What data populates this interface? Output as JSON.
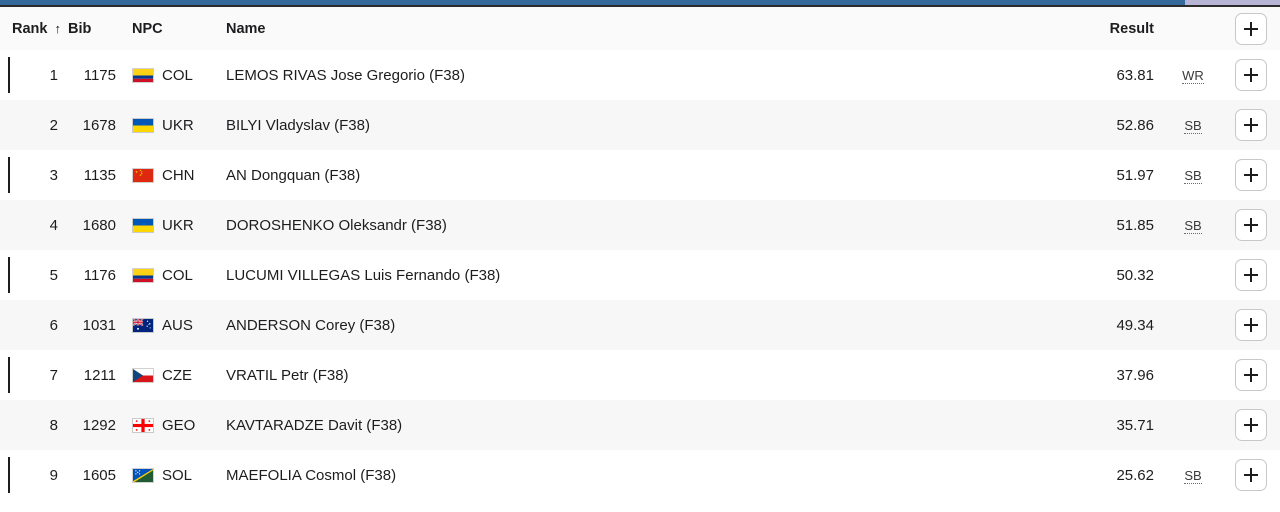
{
  "progress": {
    "name": "page-load-progress",
    "percent": 92.6,
    "fill_color": "#36699b",
    "track_color": "#b7b4d6"
  },
  "table": {
    "columns": {
      "rank": "Rank",
      "sort_indicator": "↑",
      "bib": "Bib",
      "npc": "NPC",
      "name": "Name",
      "result": "Result",
      "badge": "",
      "action": ""
    },
    "add_button_label": "+",
    "rows": [
      {
        "rank": "1",
        "bib": "1175",
        "npc": "COL",
        "flag": "flag-colombia",
        "name": "LEMOS RIVAS Jose Gregorio (",
        "class_code": "F38",
        "name_suffix": ")",
        "result": "63.81",
        "badge": "WR"
      },
      {
        "rank": "2",
        "bib": "1678",
        "npc": "UKR",
        "flag": "flag-ukraine",
        "name": "BILYI Vladyslav (",
        "class_code": "F38",
        "name_suffix": ")",
        "result": "52.86",
        "badge": "SB"
      },
      {
        "rank": "3",
        "bib": "1135",
        "npc": "CHN",
        "flag": "flag-china",
        "name": "AN Dongquan (",
        "class_code": "F38",
        "name_suffix": ")",
        "result": "51.97",
        "badge": "SB"
      },
      {
        "rank": "4",
        "bib": "1680",
        "npc": "UKR",
        "flag": "flag-ukraine",
        "name": "DOROSHENKO Oleksandr (",
        "class_code": "F38",
        "name_suffix": ")",
        "result": "51.85",
        "badge": "SB"
      },
      {
        "rank": "5",
        "bib": "1176",
        "npc": "COL",
        "flag": "flag-colombia",
        "name": "LUCUMI VILLEGAS Luis Fernando (",
        "class_code": "F38",
        "name_suffix": ")",
        "result": "50.32",
        "badge": ""
      },
      {
        "rank": "6",
        "bib": "1031",
        "npc": "AUS",
        "flag": "flag-australia",
        "name": "ANDERSON Corey (",
        "class_code": "F38",
        "name_suffix": ")",
        "result": "49.34",
        "badge": ""
      },
      {
        "rank": "7",
        "bib": "1211",
        "npc": "CZE",
        "flag": "flag-czechia",
        "name": "VRATIL Petr (",
        "class_code": "F38",
        "name_suffix": ")",
        "result": "37.96",
        "badge": ""
      },
      {
        "rank": "8",
        "bib": "1292",
        "npc": "GEO",
        "flag": "flag-georgia",
        "name": "KAVTARADZE Davit (",
        "class_code": "F38",
        "name_suffix": ")",
        "result": "35.71",
        "badge": ""
      },
      {
        "rank": "9",
        "bib": "1605",
        "npc": "SOL",
        "flag": "flag-solomon-islands",
        "name": "MAEFOLIA Cosmol (",
        "class_code": "F38",
        "name_suffix": ")",
        "result": "25.62",
        "badge": "SB"
      }
    ]
  }
}
